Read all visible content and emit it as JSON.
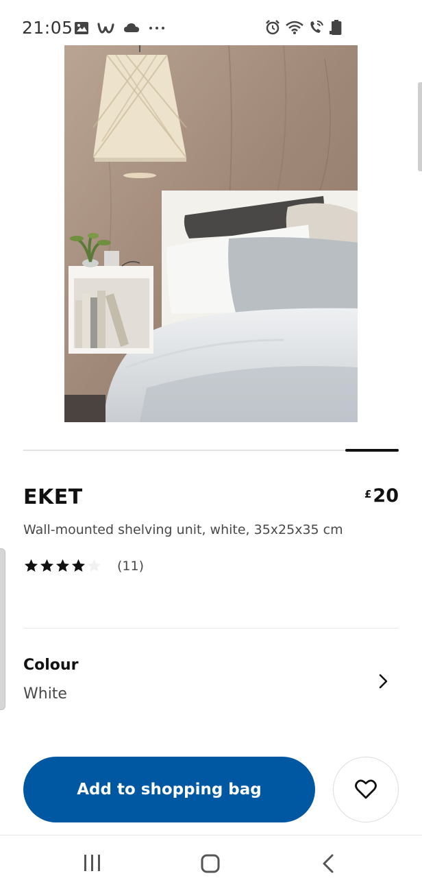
{
  "status_bar": {
    "time": "21:05",
    "left_icons": [
      "gallery-icon",
      "w-app-icon",
      "cloud-icon",
      "more-dots-icon"
    ],
    "right_icons": [
      "alarm-icon",
      "wifi-icon",
      "wifi-calling-icon",
      "signal-icon",
      "battery-icon"
    ]
  },
  "product": {
    "image": "bedroom-scene-image",
    "carousel_position": "last",
    "name": "EKET",
    "price_currency": "£",
    "price_amount": "20",
    "description": "Wall-mounted shelving unit, white, 35x25x35 cm",
    "rating_value": 4,
    "rating_max": 5,
    "rating_count": "(11)"
  },
  "colour": {
    "label": "Colour",
    "value": "White"
  },
  "actions": {
    "add_to_bag": "Add to shopping bag",
    "favourite_icon": "heart-icon"
  },
  "nav_bar": {
    "icons": [
      "recents-icon",
      "home-icon",
      "back-icon"
    ]
  },
  "colors": {
    "primary_button": "#0058a3",
    "text": "#111111",
    "secondary_text": "#484848"
  }
}
